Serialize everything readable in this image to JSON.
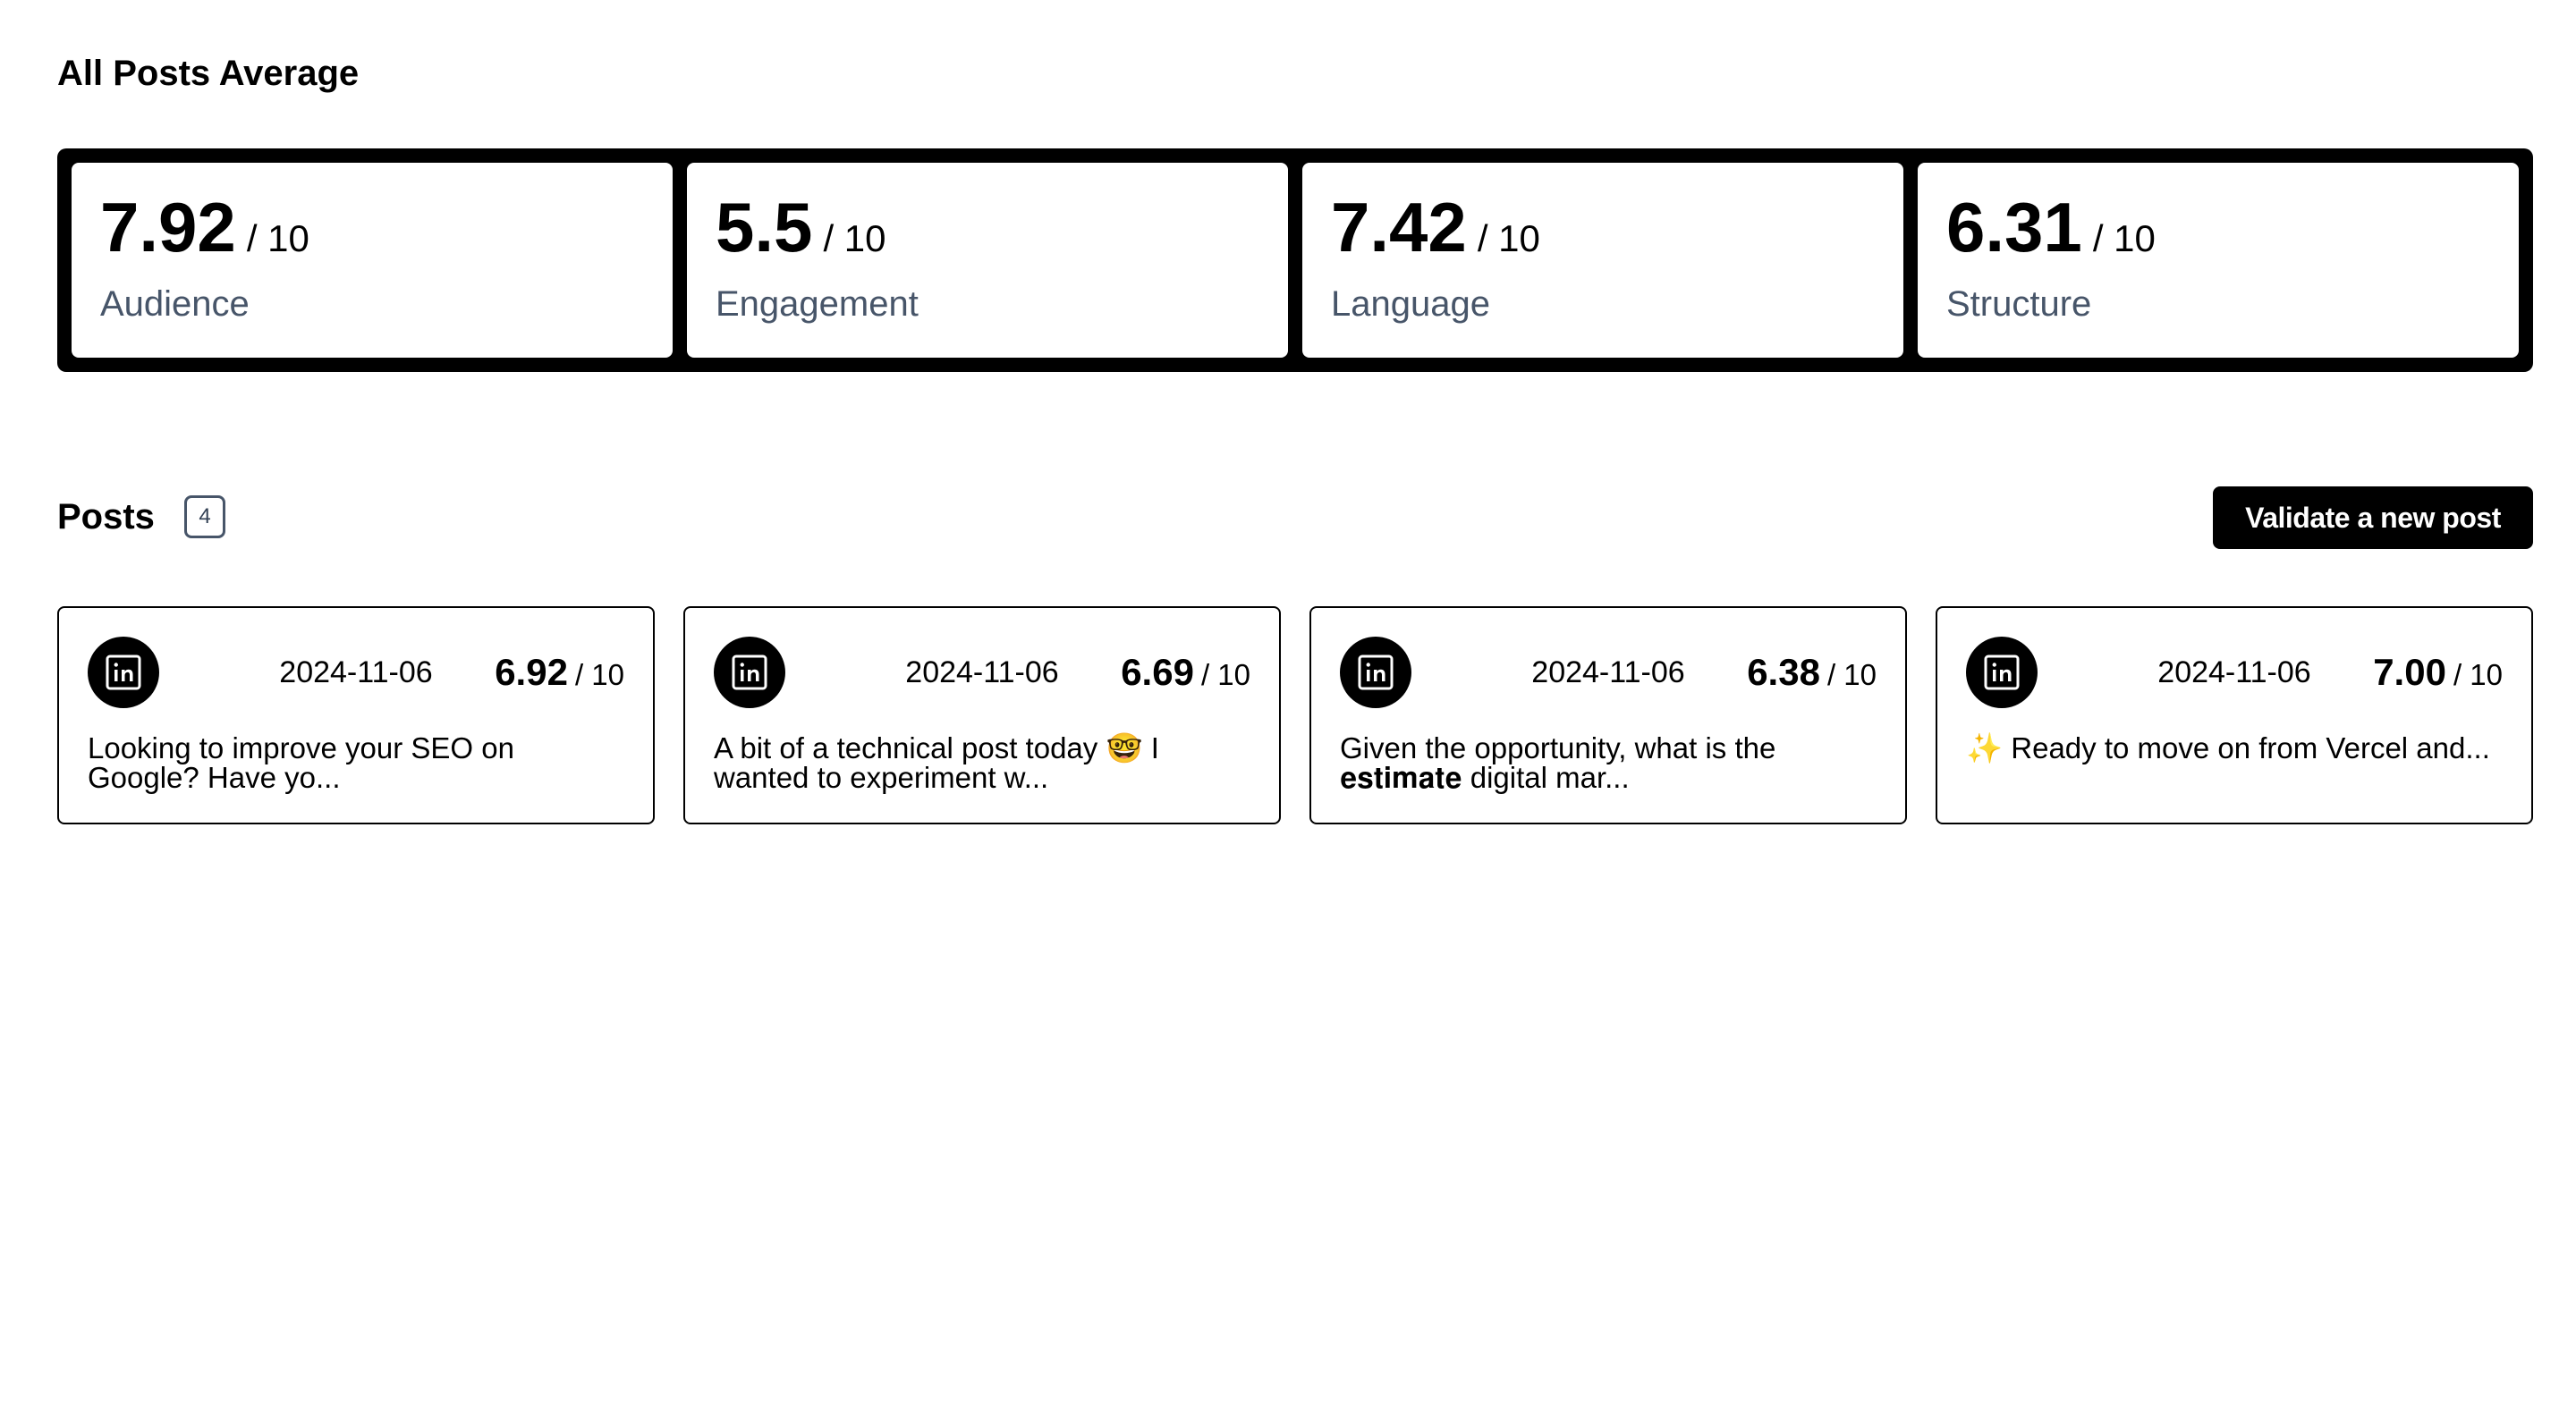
{
  "average": {
    "title": "All Posts Average",
    "cards": [
      {
        "value": "7.92",
        "outof": "/ 10",
        "label": "Audience"
      },
      {
        "value": "5.5",
        "outof": "/ 10",
        "label": "Engagement"
      },
      {
        "value": "7.42",
        "outof": "/ 10",
        "label": "Language"
      },
      {
        "value": "6.31",
        "outof": "/ 10",
        "label": "Structure"
      }
    ]
  },
  "posts": {
    "title": "Posts",
    "count": "4",
    "validate_label": "Validate a new post",
    "items": [
      {
        "icon": "linkedin-icon",
        "date": "2024-11-06",
        "score": "6.92",
        "outof": "/ 10",
        "text": "Looking to improve your SEO on Google? Have yo..."
      },
      {
        "icon": "linkedin-icon",
        "date": "2024-11-06",
        "score": "6.69",
        "outof": "/ 10",
        "text": "A bit of a technical post today 🤓 I wanted to experiment w..."
      },
      {
        "icon": "linkedin-icon",
        "date": "2024-11-06",
        "score": "6.38",
        "outof": "/ 10",
        "text": "Given the opportunity, what is the 𝐞𝐬𝐭𝐢𝐦𝐚𝐭𝐞 digital mar..."
      },
      {
        "icon": "linkedin-icon",
        "date": "2024-11-06",
        "score": "7.00",
        "outof": "/ 10",
        "text": "✨ Ready to move on from Vercel and..."
      }
    ]
  },
  "colors": {
    "label_gray": "#475569",
    "accent": "#000000",
    "background": "#ffffff"
  }
}
